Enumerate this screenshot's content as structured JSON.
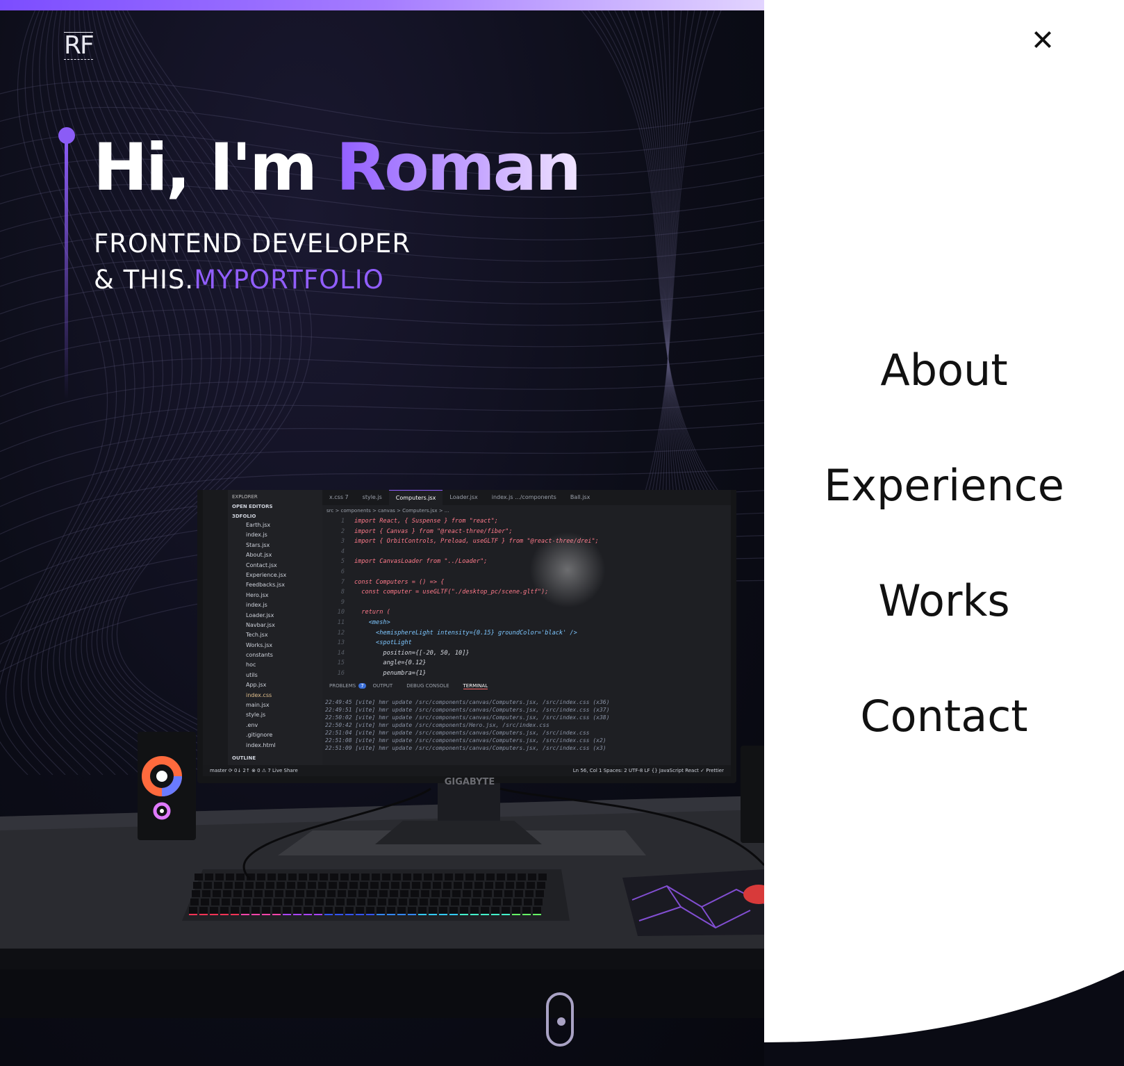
{
  "scroll_progress": 0.68,
  "logo": {
    "text": "RF"
  },
  "hero": {
    "greeting": "Hi, I'm ",
    "name": "Roman",
    "subtitle_line1": "FRONTEND DEVELOPER",
    "subtitle_line2_prefix": "& THIS.",
    "subtitle_line2_accent": "MYPORTFOLIO"
  },
  "monitor": {
    "brand": "GIGABYTE",
    "explorer_title": "EXPLORER",
    "open_editors": "OPEN EDITORS",
    "project": "3DFOLIO",
    "files": [
      "Earth.jsx",
      "index.js",
      "Stars.jsx",
      "About.jsx",
      "Contact.jsx",
      "Experience.jsx",
      "Feedbacks.jsx",
      "Hero.jsx",
      "index.js",
      "Loader.jsx",
      "Navbar.jsx",
      "Tech.jsx",
      "Works.jsx",
      "constants",
      "hoc",
      "utils",
      "App.jsx",
      "index.css",
      "main.jsx",
      "style.js",
      ".env",
      ".gitignore",
      "index.html"
    ],
    "outline": "OUTLINE",
    "tabs": [
      "x.css 7",
      "style.js",
      "Computers.jsx",
      "Loader.jsx",
      "index.js .../components",
      "Ball.jsx"
    ],
    "breadcrumb": "src > components > canvas > Computers.jsx > ...",
    "code": [
      "import React, { Suspense } from \"react\";",
      "import { Canvas } from \"@react-three/fiber\";",
      "import { OrbitControls, Preload, useGLTF } from \"@react-three/drei\";",
      "",
      "import CanvasLoader from \"../Loader\";",
      "",
      "const Computers = () => {",
      "  const computer = useGLTF(\"./desktop_pc/scene.gltf\");",
      "",
      "  return (",
      "    <mesh>",
      "      <hemisphereLight intensity={0.15} groundColor='black' />",
      "      <spotLight",
      "        position={[-20, 50, 10]}",
      "        angle={0.12}",
      "        penumbra={1}"
    ],
    "panel_tabs": [
      "PROBLEMS",
      "OUTPUT",
      "DEBUG CONSOLE",
      "TERMINAL"
    ],
    "problems_count": "7",
    "terminal": [
      "22:49:45 [vite] hmr update /src/components/canvas/Computers.jsx, /src/index.css (x36)",
      "22:49:51 [vite] hmr update /src/components/canvas/Computers.jsx, /src/index.css (x37)",
      "22:50:02 [vite] hmr update /src/components/canvas/Computers.jsx, /src/index.css (x38)",
      "22:50:42 [vite] hmr update /src/components/Hero.jsx, /src/index.css",
      "22:51:04 [vite] hmr update /src/components/canvas/Computers.jsx, /src/index.css",
      "22:51:08 [vite] hmr update /src/components/canvas/Computers.jsx, /src/index.css (x2)",
      "22:51:09 [vite] hmr update /src/components/canvas/Computers.jsx, /src/index.css (x3)"
    ],
    "status_left": "master   ⟳ 0↓ 2↑   ⊗ 0 ⚠ 7   Live Share",
    "status_right": "Ln 56, Col 1   Spaces: 2   UTF-8   LF   {} JavaScript React   ✓ Prettier"
  },
  "menu": {
    "items": [
      {
        "label": "About"
      },
      {
        "label": "Experience"
      },
      {
        "label": "Works"
      },
      {
        "label": "Contact"
      }
    ]
  },
  "colors": {
    "accent": "#915eff",
    "background": "#0a0b14",
    "menu_bg": "#ffffff"
  },
  "icons": [
    "close-icon",
    "scroll-mouse-icon"
  ]
}
